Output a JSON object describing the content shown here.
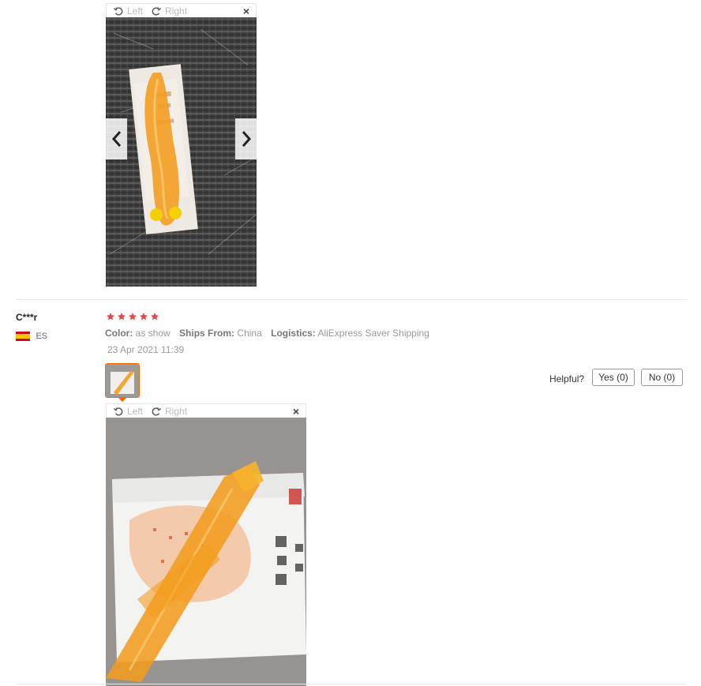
{
  "viewer": {
    "left_label": "Left",
    "right_label": "Right",
    "close_label": "×"
  },
  "review1": {
    "photo_alt": "orange plastic massager in packaging on grey fabric"
  },
  "review2": {
    "user": "C***r",
    "country": "ES",
    "rating": 5,
    "color_key": "Color:",
    "color_val": "as show",
    "ships_key": "Ships From:",
    "ships_val": "China",
    "logistics_key": "Logistics:",
    "logistics_val": "AliExpress Saver Shipping",
    "date": "23 Apr 2021 11:39",
    "helpful_label": "Helpful?",
    "yes_label": "Yes (0)",
    "no_label": "No (0)"
  },
  "colors": {
    "star": "#e64545",
    "accent": "#ff6600",
    "orange_product": "#f39c1e"
  }
}
